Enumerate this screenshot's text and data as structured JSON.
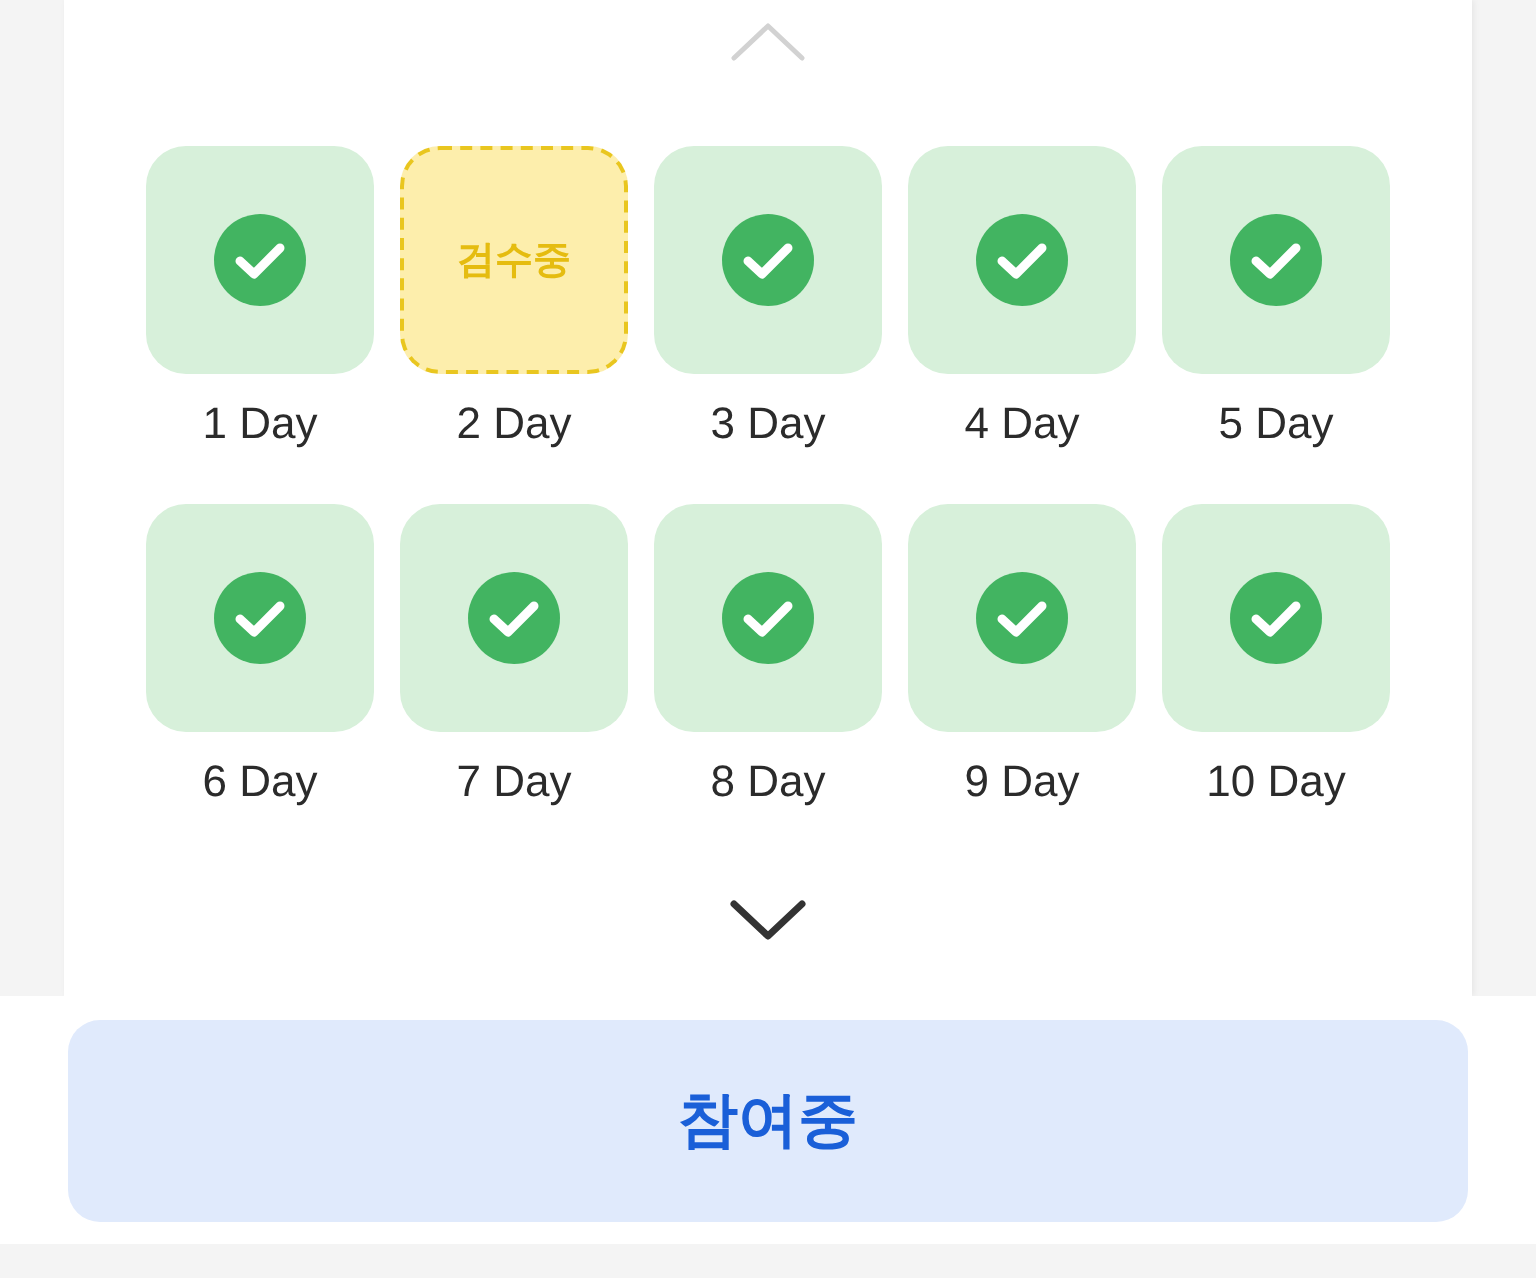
{
  "scroll_up": {
    "disabled": true
  },
  "days": [
    {
      "label": "1 Day",
      "kind": "done"
    },
    {
      "label": "2 Day",
      "kind": "reviewing",
      "status": "검수중"
    },
    {
      "label": "3 Day",
      "kind": "done"
    },
    {
      "label": "4 Day",
      "kind": "done"
    },
    {
      "label": "5 Day",
      "kind": "done"
    },
    {
      "label": "6 Day",
      "kind": "done"
    },
    {
      "label": "7 Day",
      "kind": "done"
    },
    {
      "label": "8 Day",
      "kind": "done"
    },
    {
      "label": "9 Day",
      "kind": "done"
    },
    {
      "label": "10 Day",
      "kind": "done"
    }
  ],
  "scroll_down": {
    "disabled": false
  },
  "action_button": {
    "label": "참여중"
  }
}
